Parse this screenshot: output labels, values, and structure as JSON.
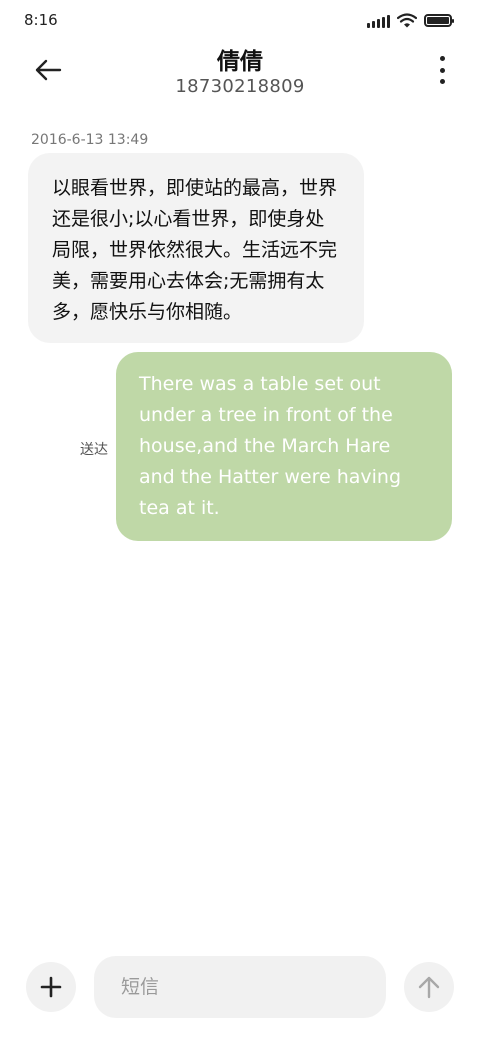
{
  "status_bar": {
    "time": "8:16",
    "icons": [
      "signal-icon",
      "wifi-icon",
      "battery-icon"
    ]
  },
  "header": {
    "contact_name": "倩倩",
    "contact_number": "18730218809",
    "back_icon": "arrow-left-icon",
    "more_icon": "more-vertical-icon"
  },
  "messages": [
    {
      "direction": "incoming",
      "timestamp": "2016-6-13 13:49",
      "text": "以眼看世界，即使站的最高，世界还是很小;以心看世界，即使身处局限，世界依然很大。生活远不完美，需要用心去体会;无需拥有太多，愿快乐与你相随。"
    },
    {
      "direction": "outgoing",
      "status": "送达",
      "text": "There was a table set out under a tree in front of the house,and the March Hare and the Hatter were having tea at it."
    }
  ],
  "composer": {
    "placeholder": "短信",
    "value": "",
    "add_icon": "plus-icon",
    "send_icon": "arrow-up-icon"
  },
  "colors": {
    "outgoing_bubble": "#bfd8a7",
    "incoming_bubble": "#f3f3f3",
    "composer_bg": "#f1f1f1"
  }
}
